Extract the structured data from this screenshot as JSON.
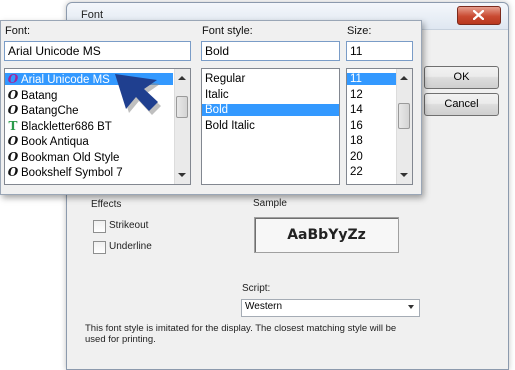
{
  "dialog": {
    "title": "Font",
    "buttons": {
      "ok": "OK",
      "cancel": "Cancel"
    },
    "effects": {
      "label": "Effects",
      "strikeout": {
        "label": "Strikeout",
        "checked": false
      },
      "underline": {
        "label": "Underline",
        "checked": false
      }
    },
    "sample": {
      "label": "Sample",
      "text": "AaBbYyZz"
    },
    "script": {
      "label": "Script:",
      "value": "Western"
    },
    "info_text": "This font style is imitated for the display. The closest matching style will be used for printing."
  },
  "zoom": {
    "font": {
      "label": "Font:",
      "value": "Arial Unicode MS",
      "items": [
        {
          "label": "Arial Unicode MS",
          "icon": "opentype-icon",
          "selected": true
        },
        {
          "label": "Batang",
          "icon": "opentype-icon",
          "selected": false
        },
        {
          "label": "BatangChe",
          "icon": "opentype-icon",
          "selected": false
        },
        {
          "label": "Blackletter686 BT",
          "icon": "truetype-icon",
          "selected": false
        },
        {
          "label": "Book Antiqua",
          "icon": "opentype-icon",
          "selected": false
        },
        {
          "label": "Bookman Old Style",
          "icon": "opentype-icon",
          "selected": false
        },
        {
          "label": "Bookshelf Symbol 7",
          "icon": "opentype-icon",
          "selected": false
        }
      ]
    },
    "style": {
      "label": "Font style:",
      "value": "Bold",
      "items": [
        {
          "label": "Regular",
          "selected": false
        },
        {
          "label": "Italic",
          "selected": false
        },
        {
          "label": "Bold",
          "selected": true
        },
        {
          "label": "Bold Italic",
          "selected": false
        }
      ]
    },
    "size": {
      "label": "Size:",
      "value": "11",
      "items": [
        {
          "label": "11",
          "selected": true
        },
        {
          "label": "12",
          "selected": false
        },
        {
          "label": "14",
          "selected": false
        },
        {
          "label": "16",
          "selected": false
        },
        {
          "label": "18",
          "selected": false
        },
        {
          "label": "20",
          "selected": false
        },
        {
          "label": "22",
          "selected": false
        }
      ]
    }
  },
  "colors": {
    "selection": "#3399ff",
    "accent_icon": "#a0269b",
    "pointer": "#1f3f8f"
  }
}
